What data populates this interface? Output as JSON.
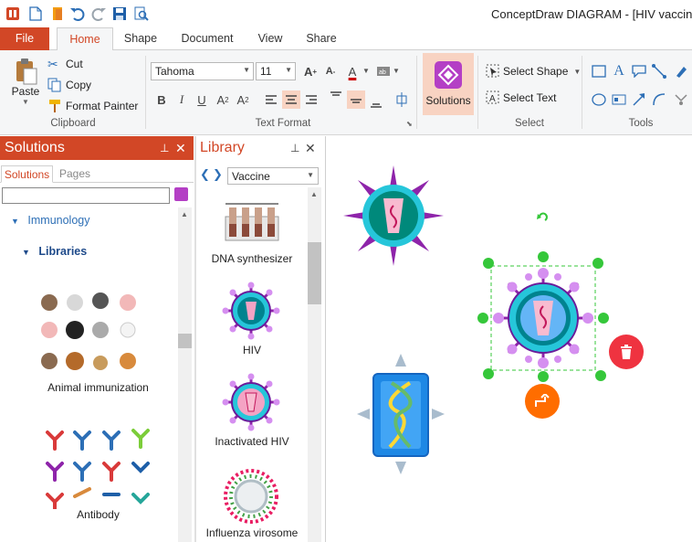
{
  "window": {
    "title": "ConceptDraw DIAGRAM - [HIV vaccine de"
  },
  "quick_access": [
    {
      "icon": "app-logo-icon"
    },
    {
      "icon": "new-document-icon"
    },
    {
      "icon": "open-document-icon"
    },
    {
      "icon": "undo-icon"
    },
    {
      "icon": "redo-icon"
    },
    {
      "icon": "save-icon"
    },
    {
      "icon": "print-preview-icon"
    }
  ],
  "tabs": [
    "File",
    "Home",
    "Shape",
    "Document",
    "View",
    "Share"
  ],
  "ribbon": {
    "clipboard": {
      "paste": "Paste",
      "cut": "Cut",
      "copy": "Copy",
      "format_painter": "Format Painter",
      "label": "Clipboard"
    },
    "text_format": {
      "font": "Tahoma",
      "size": "11",
      "label": "Text Format"
    },
    "solutions": {
      "label": "Solutions"
    },
    "select": {
      "select_shape": "Select Shape",
      "select_text": "Select Text",
      "label": "Select"
    },
    "tools": {
      "label": "Tools"
    }
  },
  "solutions_panel": {
    "title": "Solutions",
    "tabs": [
      "Solutions",
      "Pages"
    ],
    "search_placeholder": "",
    "tree": {
      "category": "Immunology",
      "section": "Libraries"
    },
    "libraries": [
      {
        "label": "Animal immunization"
      },
      {
        "label": "Antibody"
      }
    ]
  },
  "library_panel": {
    "title": "Library",
    "selected": "Vaccine",
    "items": [
      {
        "label": "DNA synthesizer"
      },
      {
        "label": "HIV"
      },
      {
        "label": "Inactivated HIV"
      },
      {
        "label": "Influenza virosome"
      }
    ]
  },
  "colors": {
    "accent": "#d24726",
    "selection_handle": "#35c73a",
    "virus_purple": "#8e24aa",
    "virus_teal": "#00838f",
    "delete_button": "#ef3340",
    "connector_button": "#ff6d00"
  }
}
